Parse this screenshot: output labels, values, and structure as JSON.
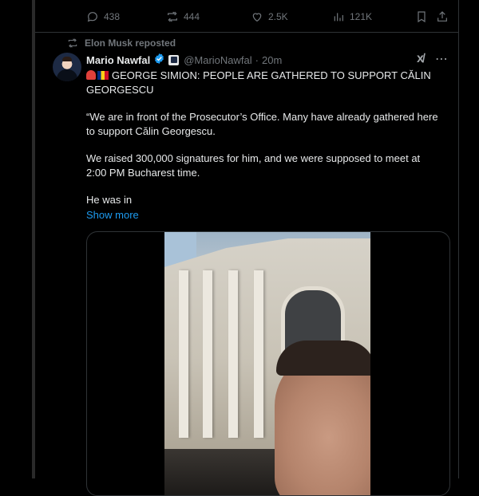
{
  "actions": {
    "replies": "438",
    "reposts": "444",
    "likes": "2.5K",
    "views": "121K"
  },
  "repost_banner": "Elon Musk reposted",
  "tweet": {
    "display_name": "Mario Nawfal",
    "handle": "@MarioNawfal",
    "separator": "·",
    "time": "20m",
    "headline": "GEORGE SIMION: PEOPLE ARE GATHERED TO SUPPORT CĂLIN GEORGESCU",
    "paragraph1": "“We are in front of the Prosecutor’s Office. Many have already gathered here to support Călin Georgescu.",
    "paragraph2": "We raised 300,000 signatures for him, and we were supposed to meet at 2:00 PM Bucharest time.",
    "paragraph3": "He was in",
    "show_more": "Show more"
  },
  "icons": {
    "reply": "reply-icon",
    "repost": "repost-icon",
    "like": "heart-icon",
    "views": "views-icon",
    "bookmark": "bookmark-icon",
    "share": "share-icon",
    "verified": "verified-badge-icon",
    "grok": "grok-icon",
    "more": "more-icon"
  },
  "colors": {
    "background": "#000000",
    "text": "#e7e9ea",
    "muted": "#71767b",
    "link": "#1d9bf0",
    "verified": "#1d9bf0"
  }
}
